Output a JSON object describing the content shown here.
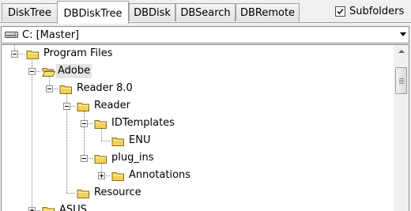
{
  "tabs": [
    {
      "label": "DiskTree",
      "active": false
    },
    {
      "label": "DBDiskTree",
      "active": true
    },
    {
      "label": "DBDisk",
      "active": false
    },
    {
      "label": "DBSearch",
      "active": false
    },
    {
      "label": "DBRemote",
      "active": false
    }
  ],
  "subfolders": {
    "label": "Subfolders",
    "checked": true
  },
  "drive": {
    "label": "C: [Master]",
    "icon": "hard-drive-icon"
  },
  "tree": {
    "nodes": [
      {
        "label": "Program Files",
        "expanded": true,
        "selected": false,
        "icon": "folder-icon"
      },
      {
        "label": "Adobe",
        "expanded": true,
        "selected": true,
        "icon": "folder-icon"
      },
      {
        "label": "Reader 8.0",
        "expanded": true,
        "selected": false,
        "icon": "folder-icon"
      },
      {
        "label": "Reader",
        "expanded": true,
        "selected": false,
        "icon": "folder-icon"
      },
      {
        "label": "IDTemplates",
        "expanded": true,
        "selected": false,
        "icon": "folder-icon"
      },
      {
        "label": "ENU",
        "expanded": null,
        "selected": false,
        "icon": "folder-icon"
      },
      {
        "label": "plug_ins",
        "expanded": true,
        "selected": false,
        "icon": "folder-icon"
      },
      {
        "label": "Annotations",
        "expanded": false,
        "selected": false,
        "icon": "folder-icon"
      },
      {
        "label": "Resource",
        "expanded": null,
        "selected": false,
        "icon": "folder-icon"
      },
      {
        "label": "ASUS",
        "expanded": false,
        "selected": false,
        "icon": "folder-icon"
      }
    ]
  },
  "colors": {
    "folder": "#f2d25a",
    "folder_outline": "#8a6d12",
    "selection": "#e3e3e3"
  }
}
